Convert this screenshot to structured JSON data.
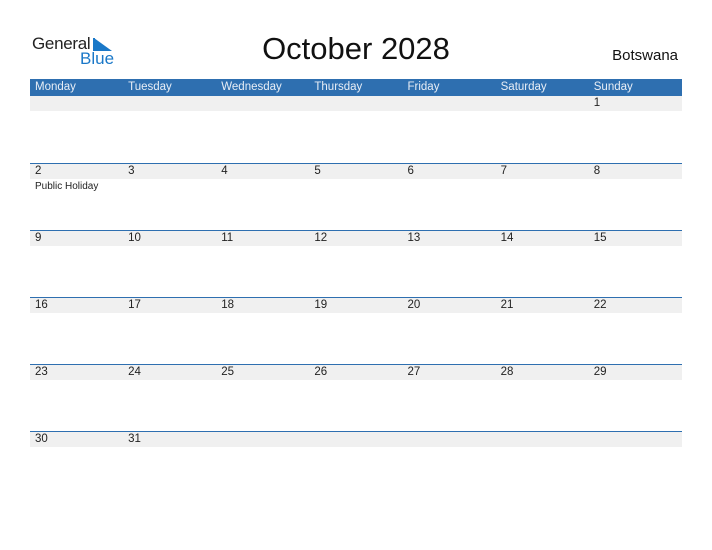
{
  "logo": {
    "general": "General",
    "blue": "Blue",
    "icon": "blue-triangle-flag-icon",
    "accent": "#1a78c8"
  },
  "title": "October 2028",
  "country": "Botswana",
  "header_color": "#2e6fb0",
  "weekdays": [
    "Monday",
    "Tuesday",
    "Wednesday",
    "Thursday",
    "Friday",
    "Saturday",
    "Sunday"
  ],
  "weeks": [
    {
      "days": [
        "",
        "",
        "",
        "",
        "",
        "",
        "1"
      ],
      "events": [
        "",
        "",
        "",
        "",
        "",
        "",
        ""
      ]
    },
    {
      "days": [
        "2",
        "3",
        "4",
        "5",
        "6",
        "7",
        "8"
      ],
      "events": [
        "Public Holiday",
        "",
        "",
        "",
        "",
        "",
        ""
      ]
    },
    {
      "days": [
        "9",
        "10",
        "11",
        "12",
        "13",
        "14",
        "15"
      ],
      "events": [
        "",
        "",
        "",
        "",
        "",
        "",
        ""
      ]
    },
    {
      "days": [
        "16",
        "17",
        "18",
        "19",
        "20",
        "21",
        "22"
      ],
      "events": [
        "",
        "",
        "",
        "",
        "",
        "",
        ""
      ]
    },
    {
      "days": [
        "23",
        "24",
        "25",
        "26",
        "27",
        "28",
        "29"
      ],
      "events": [
        "",
        "",
        "",
        "",
        "",
        "",
        ""
      ]
    },
    {
      "days": [
        "30",
        "31",
        "",
        "",
        "",
        "",
        ""
      ],
      "events": [
        "",
        "",
        "",
        "",
        "",
        "",
        ""
      ]
    }
  ]
}
